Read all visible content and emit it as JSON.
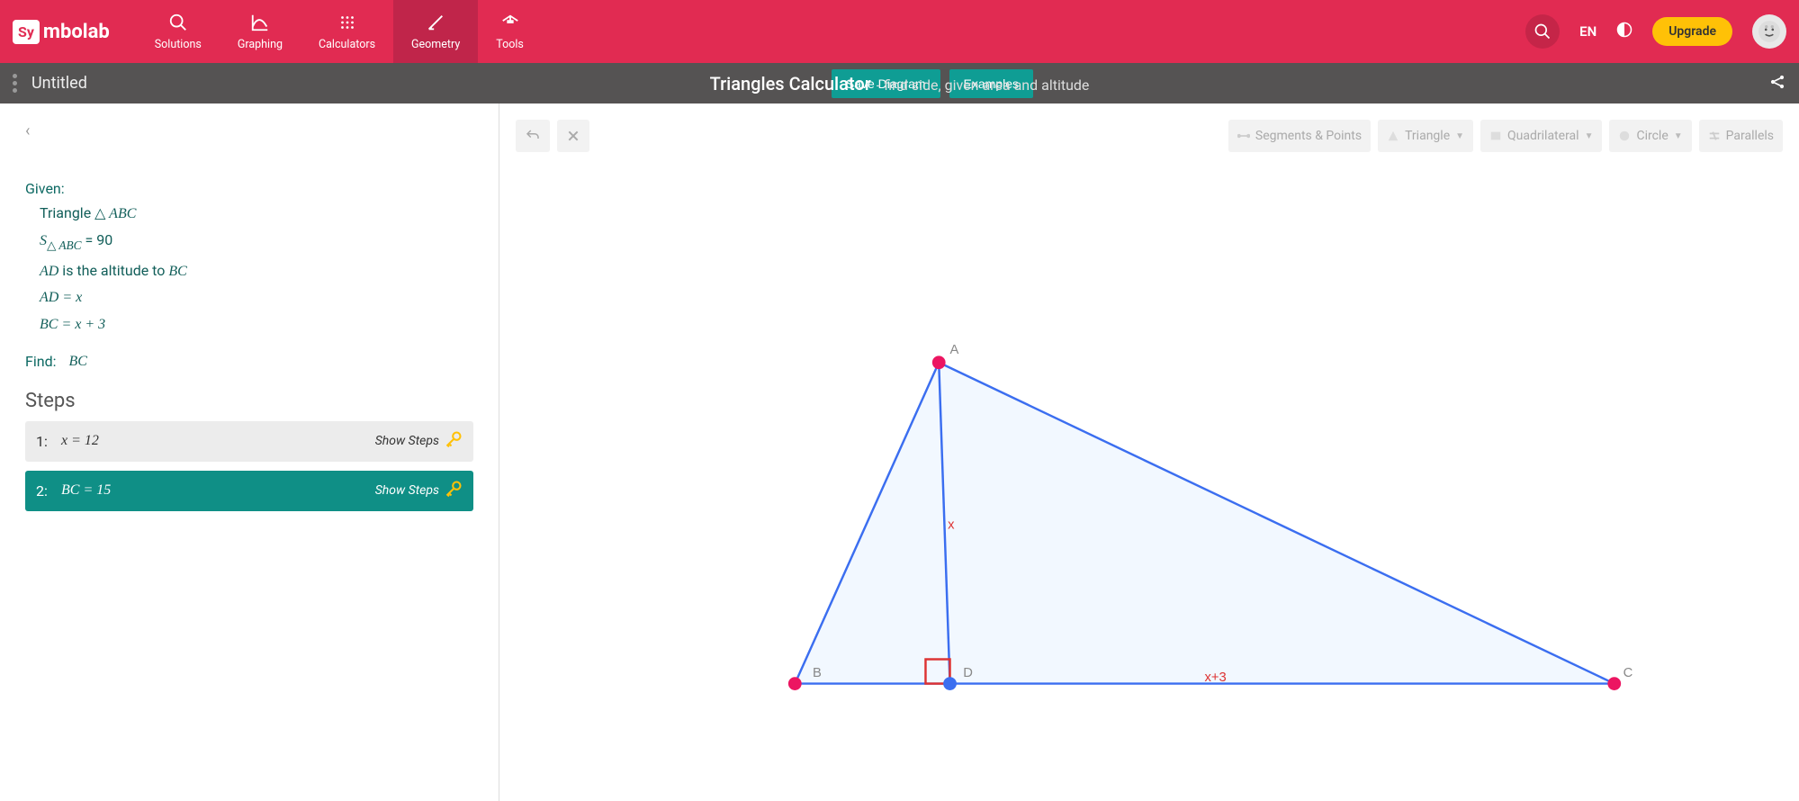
{
  "brand": {
    "short": "Sy",
    "rest": "mbolab"
  },
  "nav": {
    "solutions": "Solutions",
    "graphing": "Graphing",
    "calculators": "Calculators",
    "geometry": "Geometry",
    "tools": "Tools"
  },
  "topright": {
    "lang": "EN",
    "upgrade": "Upgrade"
  },
  "subbar": {
    "title": "Untitled",
    "save": "Save Diagram",
    "examples": "Examples",
    "calc_title": "Triangles Calculator",
    "calc_sub": "- find side, given area and altitude"
  },
  "panel": {
    "given_label": "Given:",
    "line1_pre": "Triangle ",
    "line1_tri": "△",
    "line1_abc": " ABC",
    "line2": "S△ ABC = 90",
    "line2_left": "S",
    "line2_sub": "△ ABC",
    "line2_eq": " = 90",
    "line3_a": "AD",
    "line3_mid": " is the altitude to ",
    "line3_b": "BC",
    "line4": "AD = x",
    "line5": "BC = x + 3",
    "find_label": "Find:",
    "find_val": "BC",
    "steps_header": "Steps",
    "steps": [
      {
        "num": "1:",
        "eq": "x = 12",
        "show": "Show Steps"
      },
      {
        "num": "2:",
        "eq": "BC = 15",
        "show": "Show Steps"
      }
    ]
  },
  "toolbar": {
    "segments": "Segments & Points",
    "triangle": "Triangle",
    "quad": "Quadrilateral",
    "circle": "Circle",
    "parallels": "Parallels"
  },
  "diagram": {
    "labels": {
      "A": "A",
      "B": "B",
      "C": "C",
      "D": "D",
      "x": "x",
      "xp3": "x+3"
    }
  },
  "chart_data": {
    "type": "table",
    "description": "Geometry problem: triangle ABC with area 90, altitude AD to BC, AD = x, BC = x + 3. Solve for BC.",
    "given": {
      "area_ABC": 90,
      "altitude": "AD",
      "altitude_to": "BC",
      "AD": "x",
      "BC": "x + 3"
    },
    "solutions": [
      {
        "variable": "x",
        "value": 12
      },
      {
        "variable": "BC",
        "value": 15
      }
    ]
  }
}
